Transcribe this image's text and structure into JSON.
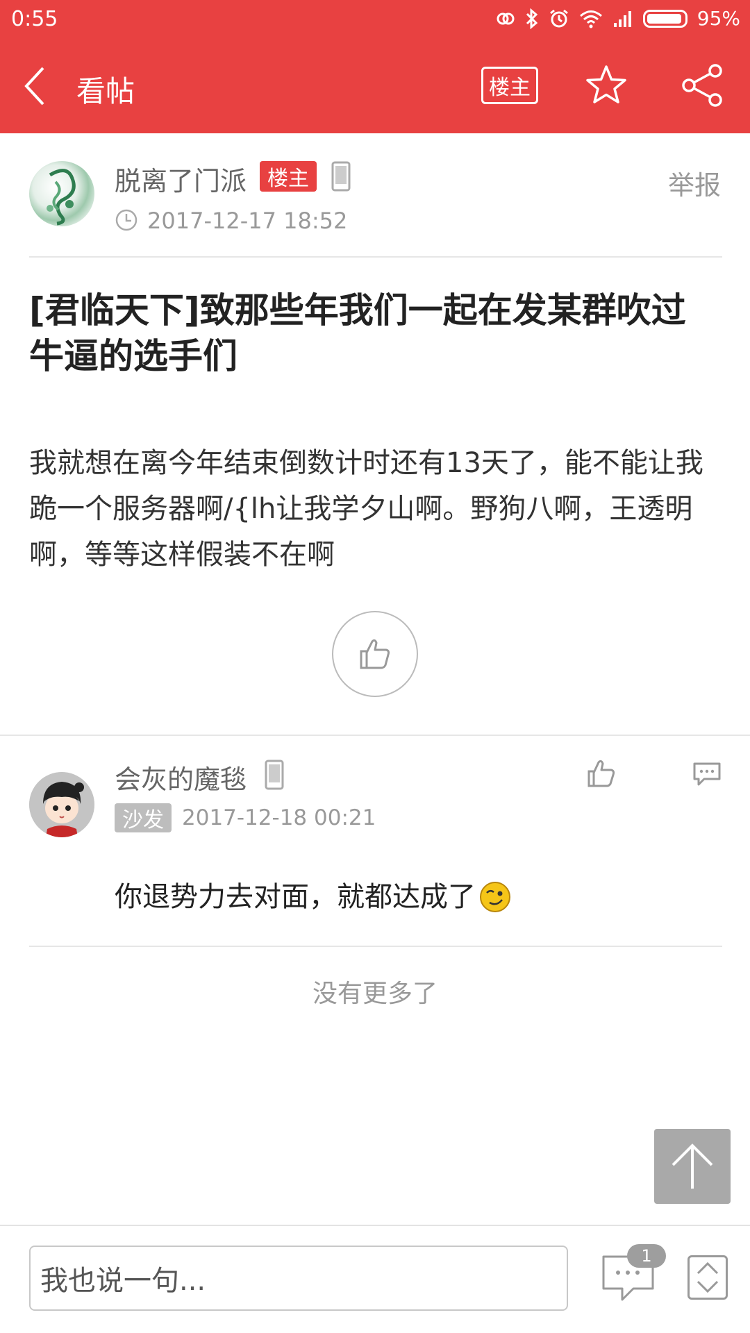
{
  "status_bar": {
    "time": "0:55",
    "battery_percent": "95%",
    "icons": [
      "link-icon",
      "bluetooth-icon",
      "alarm-icon",
      "wifi-icon",
      "signal-icon",
      "battery-icon"
    ]
  },
  "app_bar": {
    "title": "看帖",
    "louzhu_button": "楼主",
    "accent_color": "#e84141"
  },
  "post": {
    "author": "脱离了门派",
    "author_badge": "楼主",
    "report_label": "举报",
    "date": "2017-12-17 18:52",
    "title": "[君临天下]致那些年我们一起在发某群吹过牛逼的选手们",
    "body": "我就想在离今年结束倒数计时还有13天了，能不能让我跪一个服务器啊/{lh让我学夕山啊。野狗八啊，王透明啊，等等这样假装不在啊"
  },
  "replies": [
    {
      "author": "会灰的魔毯",
      "floor_label": "沙发",
      "date": "2017-12-18 00:21",
      "text": "你退势力去对面，就都达成了"
    }
  ],
  "footer": {
    "no_more_label": "没有更多了",
    "input_placeholder": "我也说一句...",
    "comment_count": "1"
  }
}
